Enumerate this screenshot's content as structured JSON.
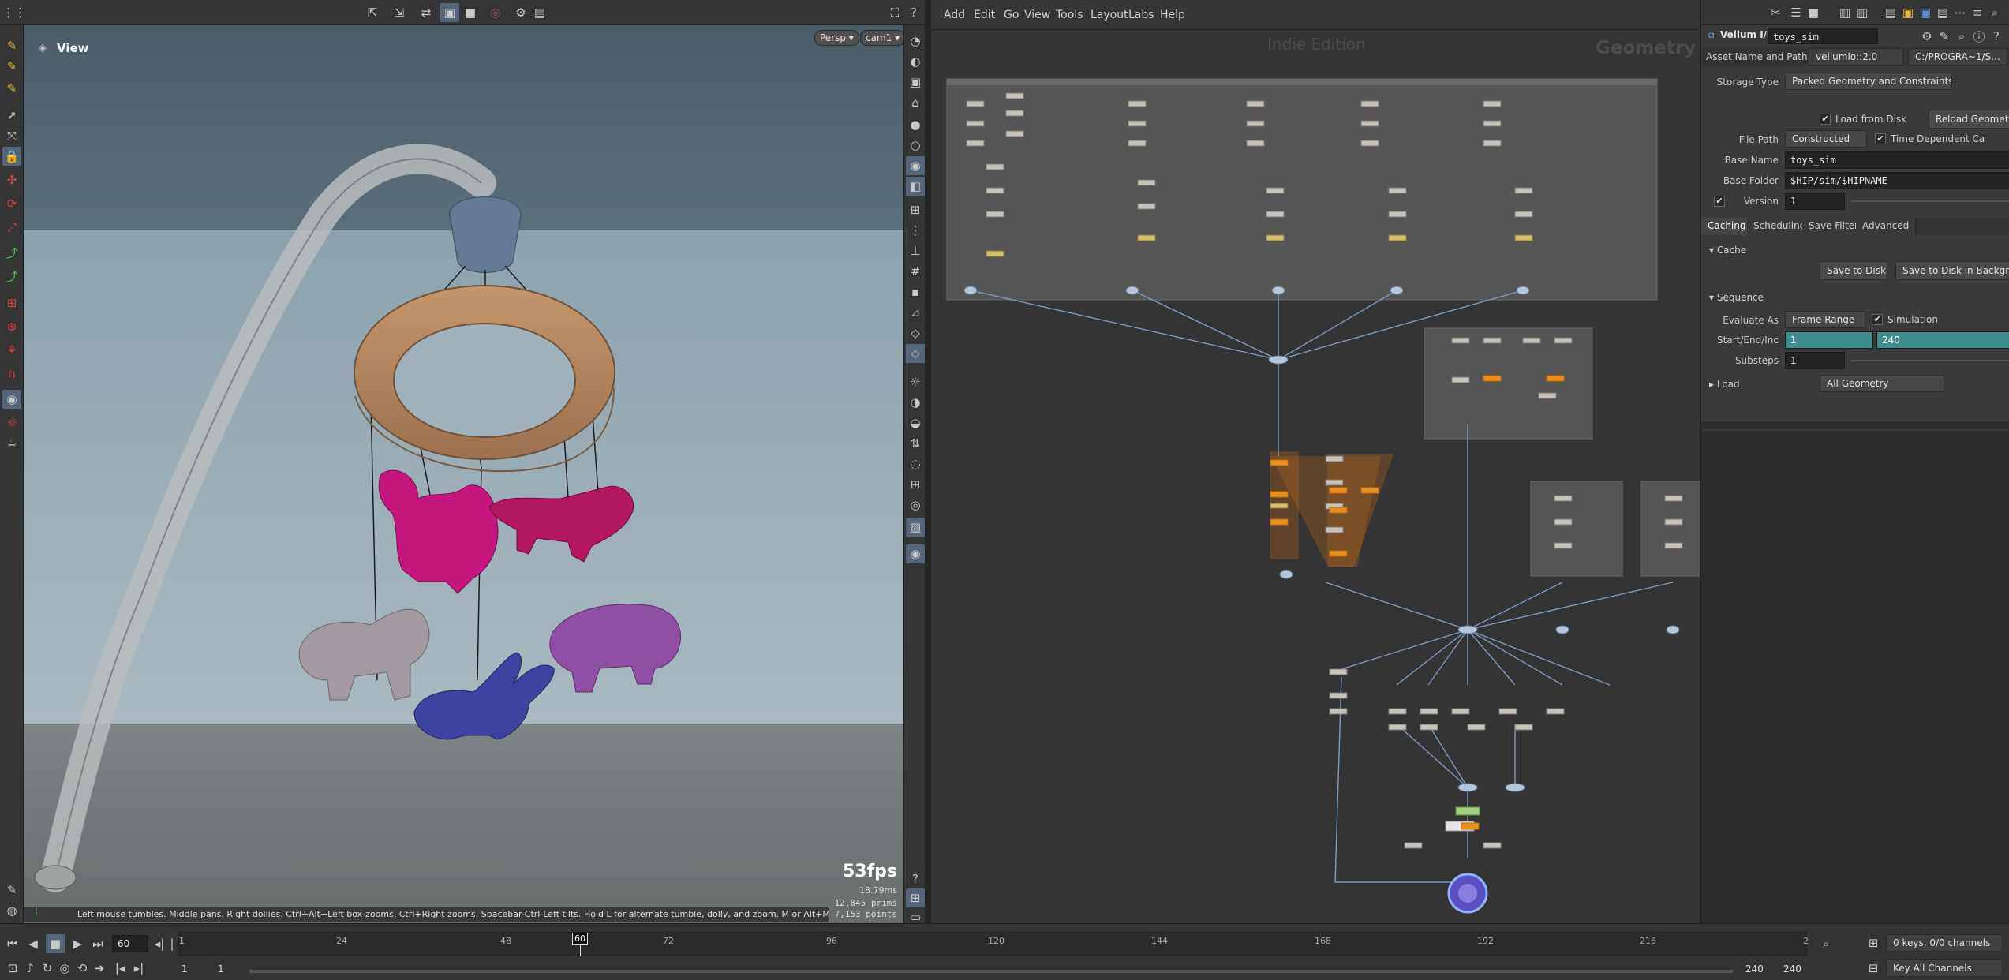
{
  "viewport": {
    "title": "View",
    "persp_label": "Persp ▾",
    "cam_label": "cam1 ▾",
    "fps": "53fps",
    "frame_ms": "18.79ms",
    "prims": "12,845  prims",
    "points": "7,153  points",
    "status_hint": "Left mouse tumbles. Middle pans. Right dollies. Ctrl+Alt+Left box-zooms. Ctrl+Right zooms. Spacebar-Ctrl-Left tilts. Hold L for alternate tumble, dolly, and zoom. M or Alt+M for First Person Navi"
  },
  "network": {
    "menu": [
      "Add",
      "Edit",
      "Go",
      "View",
      "Tools",
      "Layout",
      "Labs",
      "Help"
    ],
    "watermark": "Indie Edition",
    "context_label": "Geometry"
  },
  "params": {
    "node_type": "Vellum I/O",
    "node_name": "toys_sim",
    "asset_label": "Asset Name and Path",
    "asset_value": "vellumio::2.0",
    "asset_path": "C:/PROGRA~1/S...",
    "storage_type_label": "Storage Type",
    "storage_type_value": "Packed Geometry and Constraints",
    "load_from_disk": "Load from Disk",
    "reload_geometry": "Reload Geometry",
    "file_path_label": "File Path",
    "file_path_value": "Constructed",
    "time_dependent": "Time Dependent Ca",
    "base_name_label": "Base Name",
    "base_name_value": "toys_sim",
    "base_folder_label": "Base Folder",
    "base_folder_value": "$HIP/sim/$HIPNAME",
    "version_label": "Version",
    "version_value": "1",
    "tabs": [
      "Caching",
      "Scheduling",
      "Save Filter",
      "Advanced"
    ],
    "cache_section": "Cache",
    "save_to_disk": "Save to Disk",
    "save_background": "Save to Disk in Backgro",
    "sequence_section": "Sequence",
    "evaluate_as_label": "Evaluate As",
    "evaluate_as_value": "Frame Range",
    "simulation": "Simulation",
    "start_end_label": "Start/End/Inc",
    "start_value": "1",
    "end_value": "240",
    "substeps_label": "Substeps",
    "substeps_value": "1",
    "load_section": "Load",
    "load_value": "All Geometry"
  },
  "timeline": {
    "current_frame": "60",
    "frame_marker": "60",
    "ticks": [
      "1",
      "24",
      "48",
      "72",
      "96",
      "120",
      "144",
      "168",
      "192",
      "216",
      "2"
    ],
    "range_start": "1",
    "range_start2": "1",
    "range_end": "240",
    "range_end2": "240",
    "keys_label": "0 keys, 0/0 channels",
    "key_all": "Key All Channels"
  }
}
